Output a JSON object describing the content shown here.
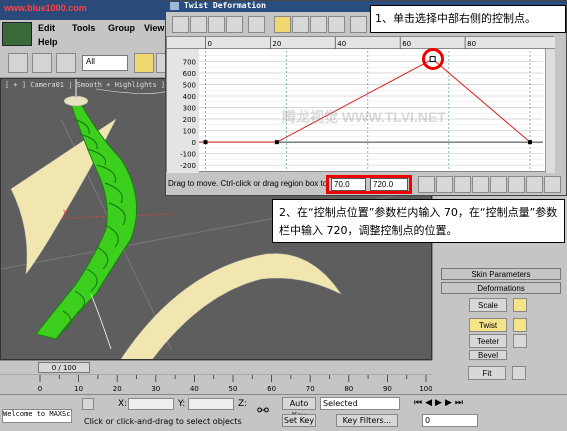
{
  "watermark_url": "www.blue1000.com",
  "menu": {
    "edit": "Edit",
    "tools": "Tools",
    "group": "Group",
    "views": "View",
    "help": "Help"
  },
  "toolbar": {
    "selection_filter": "All"
  },
  "viewport": {
    "label": "[ + ] Camera01 | Smooth + Highlights ]",
    "axis_y": "y"
  },
  "twist_window": {
    "title": "Twist Deformation",
    "ruler_ticks": [
      "0",
      "20",
      "40",
      "60",
      "80"
    ],
    "y_ticks": [
      "700",
      "600",
      "500",
      "400",
      "300",
      "200",
      "100",
      "0",
      "-100",
      "-200"
    ],
    "status_hint": "Drag to move. Ctrl-click or drag region box to",
    "position_value": "70.0",
    "amount_value": "720.0",
    "watermark": "腾龙视觉 WWW.TLVI.NET",
    "curve": {
      "points": [
        {
          "position": 0,
          "amount": 0
        },
        {
          "position": 22,
          "amount": 0
        },
        {
          "position": 70,
          "amount": 720
        },
        {
          "position": 100,
          "amount": 0
        }
      ],
      "selected_index": 2,
      "x_range": [
        -2,
        104
      ],
      "y_range": [
        -250,
        790
      ],
      "line_color": "#dd2222"
    }
  },
  "command_panel": {
    "skin_parameters": "Skin Parameters",
    "deformations": "Deformations",
    "buttons": [
      "Scale",
      "Twist",
      "Teeter",
      "Bevel",
      "Fit"
    ],
    "active_button": "Twist"
  },
  "timeslider": {
    "frame_label": "0 / 100",
    "ticks": [
      "0",
      "10",
      "20",
      "30",
      "40",
      "50",
      "60",
      "70",
      "80",
      "90",
      "100"
    ]
  },
  "statusbar": {
    "welcome": "Welcome to MAXScript.",
    "x_label": "X:",
    "y_label": "Y:",
    "z_label": "Z:",
    "prompt": "Click or click-and-drag to select objects",
    "auto_key": "Auto Key",
    "set_key": "Set Key",
    "key_mode": "Selected",
    "key_filters": "Key Filters...",
    "frame": "0"
  },
  "callouts": {
    "step1": "1、单击选择中部右侧的控制点。",
    "step2": "2、在“控制点位置”参数栏内输入 70，在“控制点量”参数栏中输入 720，调整控制点的位置。"
  }
}
